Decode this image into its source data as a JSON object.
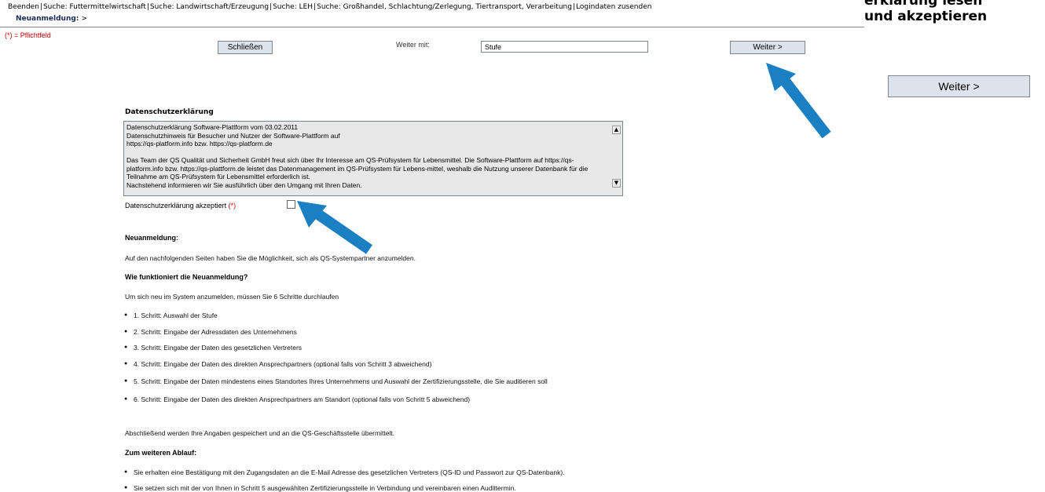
{
  "topnav": {
    "items": [
      "Beenden",
      "Suche: Futtermittelwirtschaft",
      "Suche: Landwirtschaft/Erzeugung",
      "Suche: LEH",
      "Suche: Großhandel, Schlachtung/Zerlegung, Tiertransport, Verarbeitung",
      "Logindaten zusenden"
    ],
    "separator": "|"
  },
  "breadcrumb": {
    "label": "Neuanmeldung:",
    "arrow": ">"
  },
  "required_note": "(*) = Pflichtfeld",
  "toolbar": {
    "close_label": "Schließen",
    "next_with_label": "Weiter mit:",
    "next_with_value": "Stufe",
    "next_label": "Weiter >"
  },
  "side": {
    "title_line1": "erklärung lesen",
    "title_line2": "und akzeptieren",
    "next_label": "Weiter >"
  },
  "privacy": {
    "title": "Datenschutzerklärung",
    "text": "Datenschutzerklärung Software-Plattform vom 03.02.2011\nDatenschutzhinweis für Besucher und Nutzer der Software-Plattform auf\nhttps://qs-platform.info bzw. https://qs-platform.de\n\nDas Team der QS Qualität und Sicherheit GmbH freut sich über Ihr Interesse am QS-Prüfsystem für Lebensmittel. Die Software-Plattform auf https://qs-platform.info bzw. https://qs-plattform.de leistet das Datenmanagement im QS-Prüfsystem für Lebens-mittel, weshalb die Nutzung unserer Datenbank für die Teilnahme am QS-Prüfsystem für Lebensmittel erforderlich ist.\nNachstehend informieren wir Sie ausführlich über den Umgang mit Ihren Daten.",
    "accept_label": "Datenschutzerklärung akzeptiert",
    "accept_required": "(*)",
    "accepted": false
  },
  "content": {
    "h_neuanmeldung": "Neuanmeldung:",
    "intro": "Auf den nachfolgenden Seiten haben Sie die Möglichkeit, sich als QS-Systempartner anzumelden.",
    "h_wie": "Wie funktioniert die Neuanmeldung?",
    "steps_intro": "Um sich neu im System anzumelden, müssen Sie 6 Schritte durchlaufen",
    "steps": [
      "1. Schritt: Auswahl der Stufe",
      "2. Schritt: Eingabe der Adressdaten des Unternehmens",
      "3. Schritt: Eingabe der Daten des gesetzlichen Vertreters",
      "4. Schritt: Eingabe der Daten des direkten Ansprechpartners (optional falls von Schritt 3 abweichend)",
      "5. Schritt: Eingabe der Daten mindestens eines Standortes Ihres Unternehmens und Auswahl der Zertifizierungsstelle, die Sie auditieren soll",
      "6. Schritt: Eingabe der Daten des direkten Ansprechpartners am Standort (optional falls von Schritt 5 abweichend)"
    ],
    "closing": "Abschließend werden Ihre Angaben gespeichert und an die QS-Geschäftsstelle übermittelt.",
    "h_ablauf": "Zum weiteren Ablauf:",
    "ablauf": [
      "Sie erhalten eine Bestätigung mit den Zugangsdaten an die E-Mail Adresse des gesetzlichen Vertreters (QS-ID und Passwort zur QS-Datenbank).",
      "Sie setzen sich mit der von Ihnen in Schritt 5 ausgewählten Zertifizierungsstelle in Verbindung und vereinbaren einen Audittermin."
    ]
  },
  "colors": {
    "annotation_arrow": "#1b7fc4",
    "required": "#cc0000",
    "button_bg": "#dde3ea"
  },
  "icons": {
    "scroll_up": "triangle-up-icon",
    "scroll_down": "triangle-down-icon",
    "annotation": "arrow-icon"
  }
}
